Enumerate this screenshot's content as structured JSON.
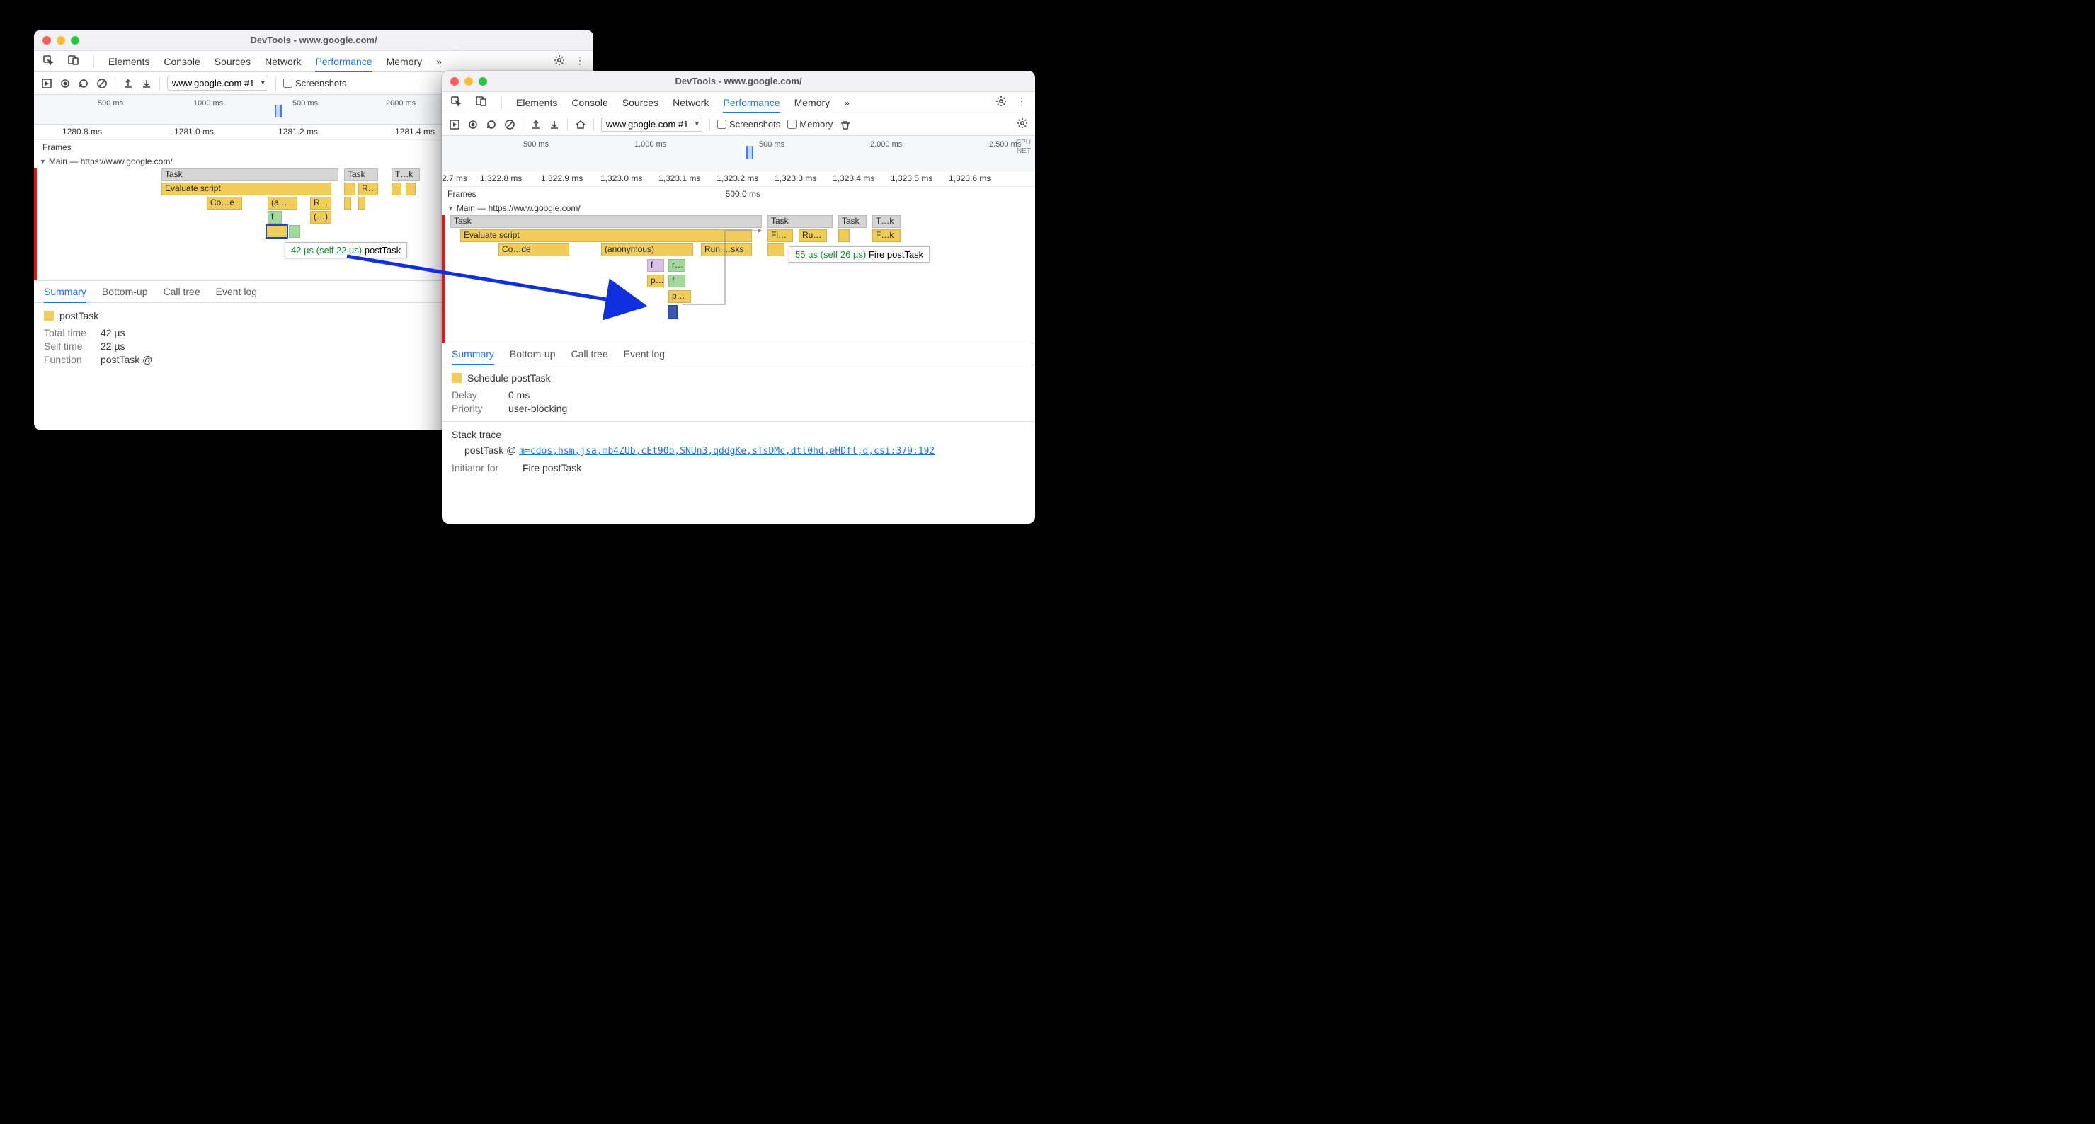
{
  "windowA": {
    "title": "DevTools - www.google.com/",
    "tabs": {
      "elements": "Elements",
      "console": "Console",
      "sources": "Sources",
      "network": "Network",
      "performance": "Performance",
      "memory": "Memory"
    },
    "toolbar": {
      "url": "www.google.com #1",
      "screenshots": "Screenshots"
    },
    "overview_ticks": [
      "500 ms",
      "1000 ms",
      "500 ms",
      "2000 ms"
    ],
    "ruler": [
      "1280.8 ms",
      "1281.0 ms",
      "1281.2 ms",
      "1281.4 ms"
    ],
    "main_label": "Main — https://www.google.com/",
    "frames_label": "Frames",
    "entries": {
      "task1": "Task",
      "task2": "Task",
      "task3": "T…k",
      "eval": "Evaluate script",
      "code": "Co…e",
      "anon": "(a…s)",
      "run": "R…s",
      "r2": "R…",
      "f": "f",
      "paren": "(…)"
    },
    "tooltip": {
      "duration": "42 µs (self 22 µs)",
      "name": "postTask"
    },
    "detail_tabs": {
      "summary": "Summary",
      "bottomup": "Bottom-up",
      "calltree": "Call tree",
      "eventlog": "Event log"
    },
    "summary": {
      "name": "postTask",
      "total_k": "Total time",
      "total_v": "42 µs",
      "self_k": "Self time",
      "self_v": "22 µs",
      "func_k": "Function",
      "func_v": "postTask @"
    }
  },
  "windowB": {
    "title": "DevTools - www.google.com/",
    "tabs": {
      "elements": "Elements",
      "console": "Console",
      "sources": "Sources",
      "network": "Network",
      "performance": "Performance",
      "memory": "Memory"
    },
    "toolbar": {
      "url": "www.google.com #1",
      "screenshots": "Screenshots",
      "memory": "Memory"
    },
    "overview_ticks": [
      "500 ms",
      "1,000 ms",
      "500 ms",
      "2,000 ms",
      "2,500 ms"
    ],
    "overview_labels": {
      "cpu": "CPU",
      "net": "NET"
    },
    "ruler": [
      "2.7 ms",
      "1,322.8 ms",
      "1,322.9 ms",
      "1,323.0 ms",
      "1,323.1 ms",
      "1,323.2 ms",
      "1,323.3 ms",
      "1,323.4 ms",
      "1,323.5 ms",
      "1,323.6 ms"
    ],
    "frames_label": "Frames",
    "frames_value": "500.0 ms",
    "main_label": "Main — https://www.google.com/",
    "entries": {
      "task1": "Task",
      "task2": "Task",
      "task3": "Task",
      "task4": "T…k",
      "eval": "Evaluate script",
      "fi": "Fi…k",
      "ru": "Ru…s",
      "fdot": "F…k",
      "code": "Co…de",
      "anon": "(anonymous)",
      "run": "Run …sks",
      "f1": "f",
      "r1": "r…",
      "p1": "p…",
      "f2": "f",
      "p2": "p…"
    },
    "tooltip": {
      "duration": "55 µs (self 26 µs)",
      "name": "Fire postTask"
    },
    "detail_tabs": {
      "summary": "Summary",
      "bottomup": "Bottom-up",
      "calltree": "Call tree",
      "eventlog": "Event log"
    },
    "summary": {
      "name": "Schedule postTask",
      "delay_k": "Delay",
      "delay_v": "0 ms",
      "priority_k": "Priority",
      "priority_v": "user-blocking",
      "stack_title": "Stack trace",
      "stack_fn": "postTask @",
      "stack_link": "m=cdos,hsm,jsa,mb4ZUb,cEt90b,SNUn3,qddgKe,sTsDMc,dtl0hd,eHDfl,d,csi:379:192",
      "initiator_k": "Initiator for",
      "initiator_v": "Fire postTask"
    }
  }
}
